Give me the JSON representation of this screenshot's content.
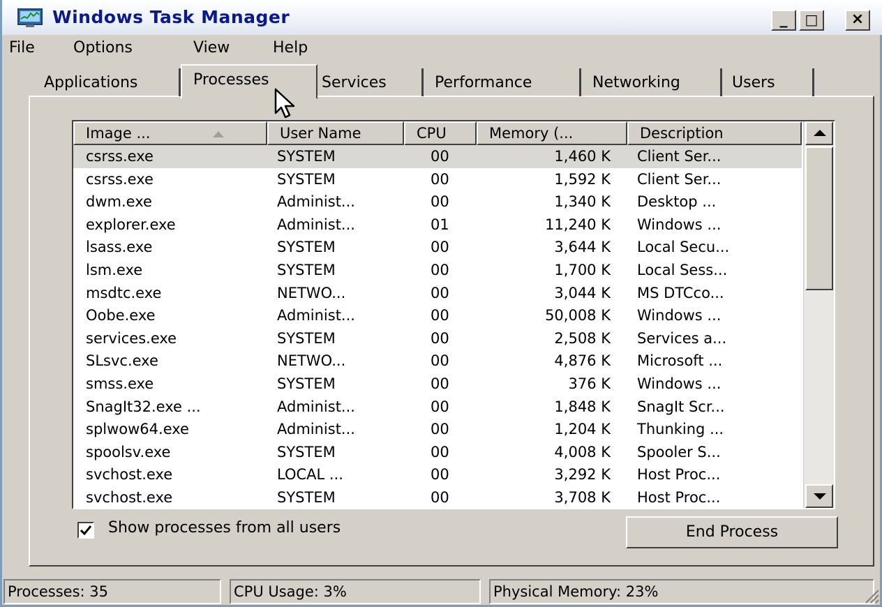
{
  "window": {
    "title": "Windows Task Manager",
    "minimize_label": "_",
    "maximize_label": "□",
    "close_label": "×"
  },
  "icons": {
    "app": "task-manager-icon",
    "cursor": "mouse-pointer-icon",
    "grip": "resize-grip-icon",
    "check": "checkmark-icon"
  },
  "menu": {
    "items": [
      "File",
      "Options",
      "View",
      "Help"
    ]
  },
  "tabs": [
    {
      "label": "Applications",
      "active": false
    },
    {
      "label": "Processes",
      "active": true
    },
    {
      "label": "Services",
      "active": false
    },
    {
      "label": "Performance",
      "active": false
    },
    {
      "label": "Networking",
      "active": false
    },
    {
      "label": "Users",
      "active": false
    }
  ],
  "table": {
    "columns": [
      "Image ...",
      "User Name",
      "CPU",
      "Memory (...",
      "Description"
    ],
    "sorted_column": "Image ...",
    "selected_row_index": 0,
    "rows": [
      [
        "csrss.exe",
        "SYSTEM",
        "00",
        "1,460 K",
        "Client Ser..."
      ],
      [
        "csrss.exe",
        "SYSTEM",
        "00",
        "1,592 K",
        "Client Ser..."
      ],
      [
        "dwm.exe",
        "Administ...",
        "00",
        "1,340 K",
        "Desktop ..."
      ],
      [
        "explorer.exe",
        "Administ...",
        "01",
        "11,240 K",
        "Windows ..."
      ],
      [
        "lsass.exe",
        "SYSTEM",
        "00",
        "3,644 K",
        "Local Secu..."
      ],
      [
        "lsm.exe",
        "SYSTEM",
        "00",
        "1,700 K",
        "Local Sess..."
      ],
      [
        "msdtc.exe",
        "NETWO...",
        "00",
        "3,044 K",
        "MS DTCco..."
      ],
      [
        "Oobe.exe",
        "Administ...",
        "00",
        "50,008 K",
        "Windows ..."
      ],
      [
        "services.exe",
        "SYSTEM",
        "00",
        "2,508 K",
        "Services a..."
      ],
      [
        "SLsvc.exe",
        "NETWO...",
        "00",
        "4,876 K",
        "Microsoft ..."
      ],
      [
        "smss.exe",
        "SYSTEM",
        "00",
        "376 K",
        "Windows ..."
      ],
      [
        "SnagIt32.exe ...",
        "Administ...",
        "00",
        "1,848 K",
        "SnagIt Scr..."
      ],
      [
        "splwow64.exe",
        "Administ...",
        "00",
        "1,204 K",
        "Thunking ..."
      ],
      [
        "spoolsv.exe",
        "SYSTEM",
        "00",
        "4,008 K",
        "Spooler S..."
      ],
      [
        "svchost.exe",
        "LOCAL ...",
        "00",
        "3,292 K",
        "Host Proc..."
      ],
      [
        "svchost.exe",
        "SYSTEM",
        "00",
        "3,708 K",
        "Host Proc..."
      ]
    ]
  },
  "options": {
    "show_all_label": "Show processes from all users",
    "show_all_checked": true
  },
  "buttons": {
    "end_process": "End Process"
  },
  "status": {
    "processes": "Processes: 35",
    "cpu": "CPU Usage: 3%",
    "memory": "Physical Memory: 23%"
  }
}
